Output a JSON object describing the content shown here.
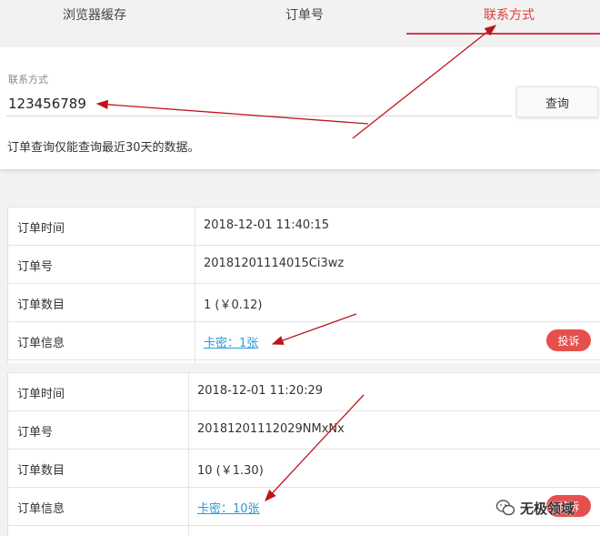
{
  "tabs": [
    {
      "label": "浏览器缓存",
      "active": false
    },
    {
      "label": "订单号",
      "active": false
    },
    {
      "label": "联系方式",
      "active": true
    }
  ],
  "search": {
    "field_label": "联系方式",
    "input_value": "123456789",
    "button_label": "查询",
    "hint": "订单查询仅能查询最近30天的数据。"
  },
  "orders": [
    {
      "time_label": "订单时间",
      "time_value": "2018-12-01 11:40:15",
      "no_label": "订单号",
      "no_value": "20181201114015Ci3wz",
      "count_label": "订单数目",
      "count_value": "1 (￥0.12)",
      "info_label": "订单信息",
      "info_value": "卡密：1张",
      "complain_label": "投诉"
    },
    {
      "time_label": "订单时间",
      "time_value": "2018-12-01 11:20:29",
      "no_label": "订单号",
      "no_value": "20181201112029NMxNx",
      "count_label": "订单数目",
      "count_value": "10 (￥1.30)",
      "info_label": "订单信息",
      "info_value": "卡密：10张",
      "complain_label": "投诉"
    }
  ],
  "watermark": {
    "text": "无极领域",
    "icon": "wechat-icon"
  },
  "colors": {
    "accent": "#e4393c",
    "link": "#2a9ad6",
    "complain": "#e5504e",
    "arrow": "#c0141b"
  }
}
